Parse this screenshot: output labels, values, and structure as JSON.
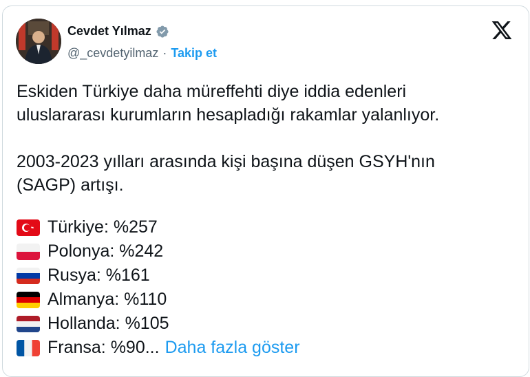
{
  "author": {
    "name": "Cevdet Yılmaz",
    "handle": "@_cevdetyilmaz",
    "separator": "·",
    "follow_label": "Takip et"
  },
  "post": {
    "paragraph1": "Eskiden Türkiye daha müreffehti diye iddia edenleri\nuluslararası kurumların hesapladığı rakamlar yalanlıyor.",
    "paragraph2": "2003-2023 yılları arasında kişi başına düşen GSYH'nın\n(SAGP) artışı.",
    "items": [
      {
        "flag": "turkey-flag-icon",
        "text": "Türkiye: %257"
      },
      {
        "flag": "poland-flag-icon",
        "text": "Polonya: %242"
      },
      {
        "flag": "russia-flag-icon",
        "text": "Rusya: %161"
      },
      {
        "flag": "germany-flag-icon",
        "text": "Almanya: %110"
      },
      {
        "flag": "netherlands-flag-icon",
        "text": "Hollanda: %105"
      },
      {
        "flag": "france-flag-icon",
        "text": "Fransa: %90..."
      }
    ],
    "show_more_label": "Daha fazla göster"
  },
  "icons": {
    "verified": "verified-badge-icon",
    "platform": "x-logo-icon"
  },
  "colors": {
    "link": "#1d9bf0",
    "secondary_text": "#536471",
    "border": "#cfd9de"
  }
}
